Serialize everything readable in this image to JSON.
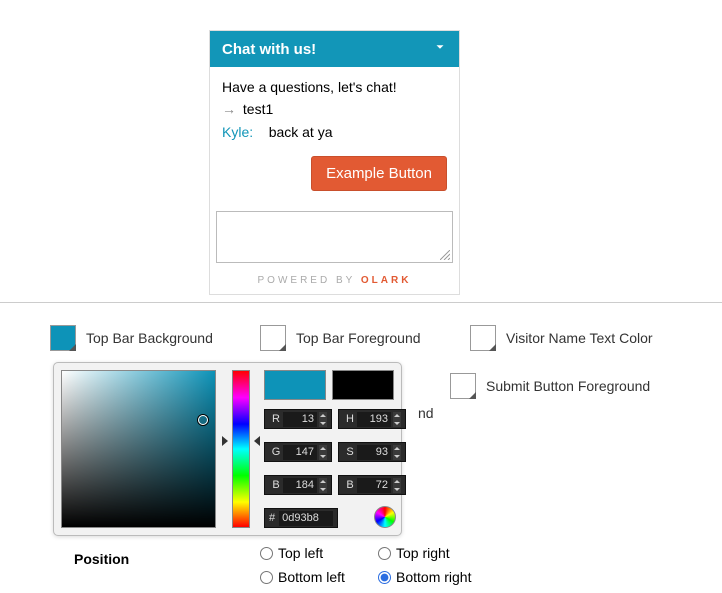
{
  "chat": {
    "header": "Chat with us!",
    "prompt": "Have a questions, let's chat!",
    "arrow_msg": "test1",
    "sender": "Kyle:",
    "reply": "back at ya",
    "example_button": "Example Button",
    "powered_prefix": "POWERED BY",
    "powered_brand": "OLARK"
  },
  "options": {
    "top_bar_bg": {
      "label": "Top Bar Background",
      "color": "#0d93b8"
    },
    "top_bar_fg": {
      "label": "Top Bar Foreground",
      "color": "#ffffff"
    },
    "visitor_name": {
      "label": "Visitor Name Text Color",
      "color": "#ffffff"
    },
    "submit_fg": {
      "label": "Submit Button Foreground",
      "color": "#ffffff"
    }
  },
  "picker": {
    "r": "13",
    "g": "147",
    "b": "184",
    "h": "193",
    "s": "93",
    "v": "72",
    "hex": "0d93b8",
    "labels": {
      "r": "R",
      "g": "G",
      "b": "B",
      "h": "H",
      "s": "S",
      "v": "B",
      "hash": "#"
    }
  },
  "hidden_behind": "nd",
  "position": {
    "label": "Position",
    "top_left": "Top left",
    "top_right": "Top right",
    "bottom_left": "Bottom left",
    "bottom_right": "Bottom right",
    "selected": "bottom_right"
  }
}
